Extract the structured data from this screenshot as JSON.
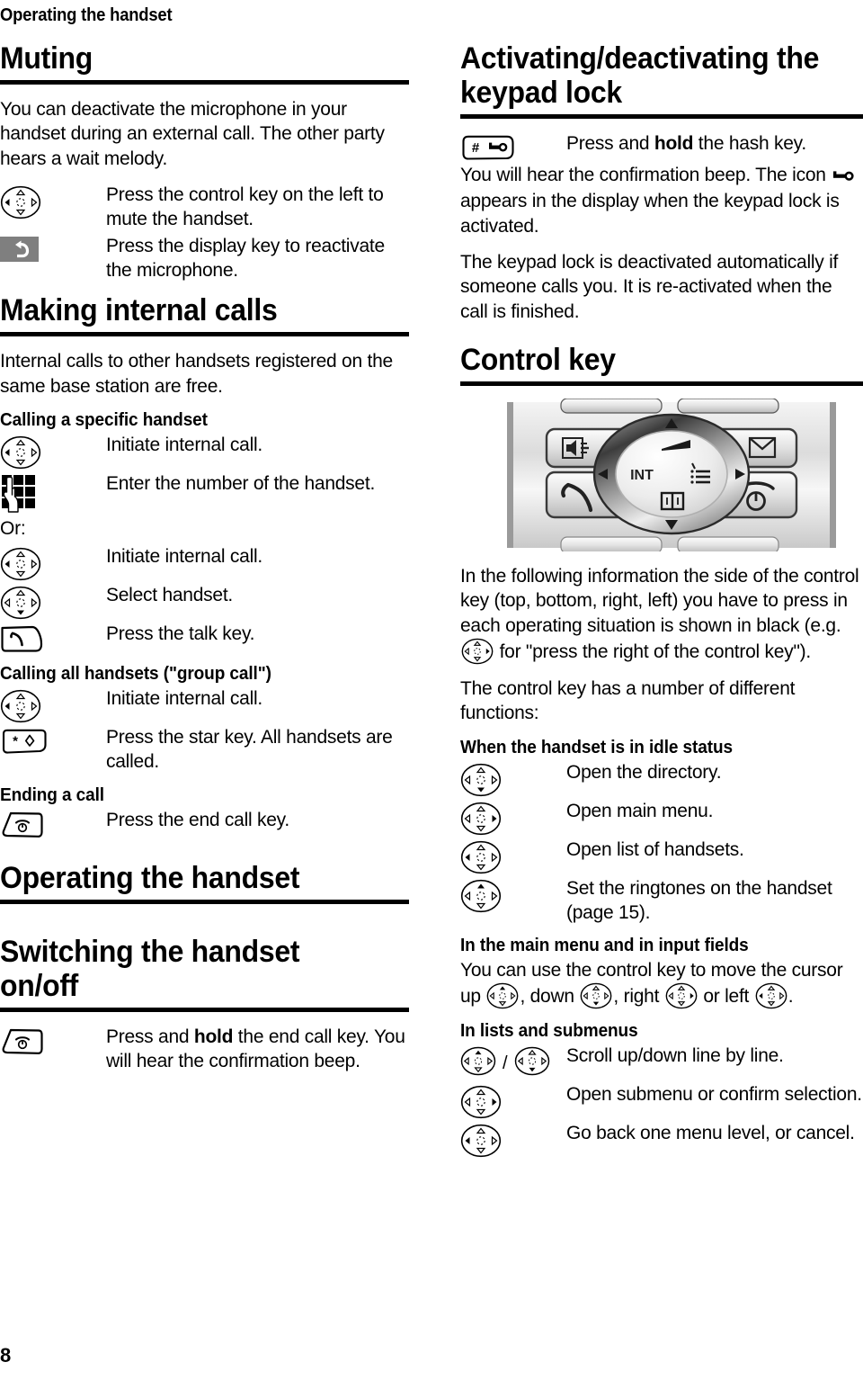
{
  "running_head": "Operating the handset",
  "page_number": "8",
  "left_column": {
    "muting": {
      "heading": "Muting",
      "intro": "You can deactivate the microphone in your handset during an external call. The other party hears a wait melody.",
      "rows": [
        {
          "icon": "control-key-left-icon",
          "text": "Press the control key on the left to mute the handset."
        },
        {
          "icon": "display-key-back-icon",
          "text": "Press the display key to reactivate the microphone."
        }
      ]
    },
    "making_internal_calls": {
      "heading": "Making internal calls",
      "intro": "Internal calls to other handsets registered on the same base station are free.",
      "calling_specific": {
        "subheading": "Calling a specific handset",
        "rows": [
          {
            "icon": "control-key-left-icon",
            "text": "Initiate internal call."
          },
          {
            "icon": "keypad-icon",
            "text": "Enter the number of the handset."
          }
        ],
        "or_label": "Or:",
        "rows2": [
          {
            "icon": "control-key-left-icon",
            "text": "Initiate internal call."
          },
          {
            "icon": "control-key-down-icon",
            "text": "Select handset."
          },
          {
            "icon": "talk-key-icon",
            "text": "Press the talk key."
          }
        ]
      },
      "calling_all": {
        "subheading": "Calling all handsets (\"group call\")",
        "rows": [
          {
            "icon": "control-key-left-icon",
            "text": "Initiate internal call."
          },
          {
            "icon": "star-key-icon",
            "text": "Press the star key. All handsets are called."
          }
        ]
      },
      "ending": {
        "subheading": "Ending a call",
        "rows": [
          {
            "icon": "end-call-key-icon",
            "text": "Press the end call key."
          }
        ]
      }
    },
    "operating_the_handset": {
      "heading": "Operating the handset",
      "switching": {
        "heading": "Switching the handset on/off",
        "row_icon": "end-call-key-icon",
        "row_text_a": "Press and ",
        "row_text_bold": "hold",
        "row_text_b": " the end call key. You will hear the confirmation beep."
      }
    }
  },
  "right_column": {
    "keypad_lock": {
      "heading": "Activating/deactivating the keypad lock",
      "row": {
        "icon": "hash-key-icon",
        "text_a": "Press and ",
        "text_bold": "hold",
        "text_b": " the hash key."
      },
      "para1_a": "You will hear the confirmation beep. The icon ",
      "para1_icon": "key-lock-icon",
      "para1_b": " appears in the display when the keypad lock is activated.",
      "para2": "The keypad lock is deactivated automatically if someone calls you. It is re-activated when the call is finished."
    },
    "control_key": {
      "heading": "Control key",
      "photo": {
        "name": "control-key-photo",
        "center_label": "INT",
        "keys": [
          "speaker-icon",
          "envelope-icon",
          "talk-key-icon",
          "end-call-key-icon",
          "menu-icon",
          "directory-book-icon",
          "volume-icon",
          "arrow-up-icon",
          "arrow-down-icon",
          "arrow-left-icon",
          "arrow-right-icon"
        ]
      },
      "para1_a": "In the following information the side of the control key (top, bottom, right, left) you have to press in each operating situation is shown in black (e.g. ",
      "para1_icon": "control-key-right-icon",
      "para1_b": " for \"press the right of the control key\").",
      "para2": "The control key has a number of different functions:",
      "idle": {
        "subheading": "When the handset is in idle status",
        "rows": [
          {
            "icon": "control-key-down-icon",
            "text": "Open the directory."
          },
          {
            "icon": "control-key-right-icon",
            "text": "Open main menu."
          },
          {
            "icon": "control-key-left-icon",
            "text": "Open list of handsets."
          },
          {
            "icon": "control-key-up-icon",
            "text": "Set the ringtones on the handset (page 15)."
          }
        ]
      },
      "main_menu": {
        "subheading": "In the main menu and in input fields",
        "text_a": "You can use the control key to move the cursor up ",
        "icon_up": "control-key-up-icon",
        "text_b": ", down ",
        "icon_down": "control-key-down-icon",
        "text_c": ", right ",
        "icon_right": "control-key-right-icon",
        "text_d": " or left ",
        "icon_left": "control-key-left-icon",
        "text_e": "."
      },
      "lists": {
        "subheading": "In lists and submenus",
        "rows": [
          {
            "icons": [
              "control-key-up-icon",
              "control-key-down-icon"
            ],
            "separator": "/",
            "text": "Scroll up/down line by line."
          },
          {
            "icon": "control-key-right-icon",
            "text": "Open submenu or confirm selection."
          },
          {
            "icon": "control-key-left-icon",
            "text": "Go back one menu level, or cancel."
          }
        ]
      }
    }
  },
  "colors": {
    "ink": "#000000",
    "display_key_bg": "#7f7f7f",
    "photo_light": "#e9e9e9",
    "photo_mid": "#bdbdbd",
    "photo_dark": "#3a3a3a"
  }
}
